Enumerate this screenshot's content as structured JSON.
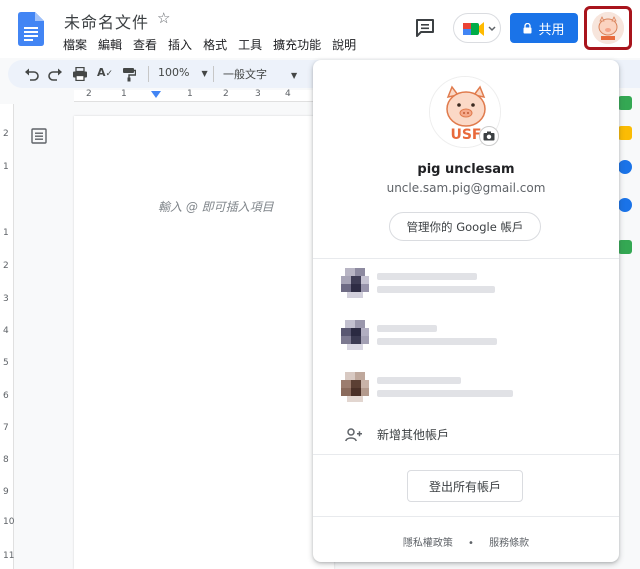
{
  "header": {
    "doc_title": "未命名文件",
    "menu": [
      "檔案",
      "編輯",
      "查看",
      "插入",
      "格式",
      "工具",
      "擴充功能",
      "說明"
    ],
    "share_label": "共用"
  },
  "toolbar": {
    "zoom": "100%",
    "style": "一般文字"
  },
  "ruler": {
    "top_numbers": [
      "2",
      "1",
      "1",
      "2",
      "3",
      "4"
    ],
    "left_numbers": [
      "2",
      "1",
      "1",
      "2",
      "3",
      "4",
      "5",
      "6",
      "7",
      "8",
      "9",
      "10",
      "11"
    ]
  },
  "document": {
    "hint": "輸入 @ 即可插入項目"
  },
  "account_popup": {
    "name": "pig unclesam",
    "email": "uncle.sam.pig@gmail.com",
    "manage_label": "管理你的 Google 帳戶",
    "add_account_label": "新增其他帳戶",
    "signout_label": "登出所有帳戶",
    "privacy_label": "隱私權政策",
    "separator": "•",
    "terms_label": "服務條款",
    "avatar_text": "USF"
  },
  "colors": {
    "share_blue": "#1a73e8",
    "avatar_highlight": "#a8141c"
  }
}
